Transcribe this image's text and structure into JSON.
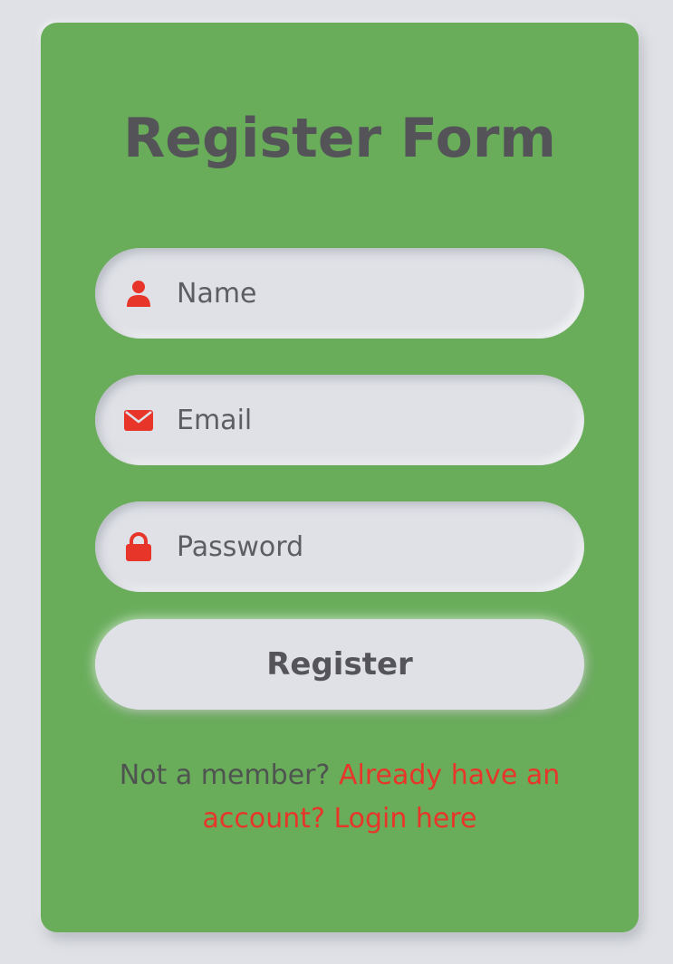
{
  "form": {
    "title": "Register Form",
    "name_field": {
      "placeholder": "Name",
      "value": "",
      "icon": "user-icon"
    },
    "email_field": {
      "placeholder": "Email",
      "value": "",
      "icon": "envelope-icon"
    },
    "password_field": {
      "placeholder": "Password",
      "value": "",
      "icon": "lock-icon"
    },
    "submit_label": "Register",
    "footer_prompt": "Not a member?",
    "footer_link": "Already have an account? Login here"
  },
  "colors": {
    "background": "#dfe1e6",
    "card": "#69ad5b",
    "accent": "#e8352a",
    "text": "#545458"
  }
}
